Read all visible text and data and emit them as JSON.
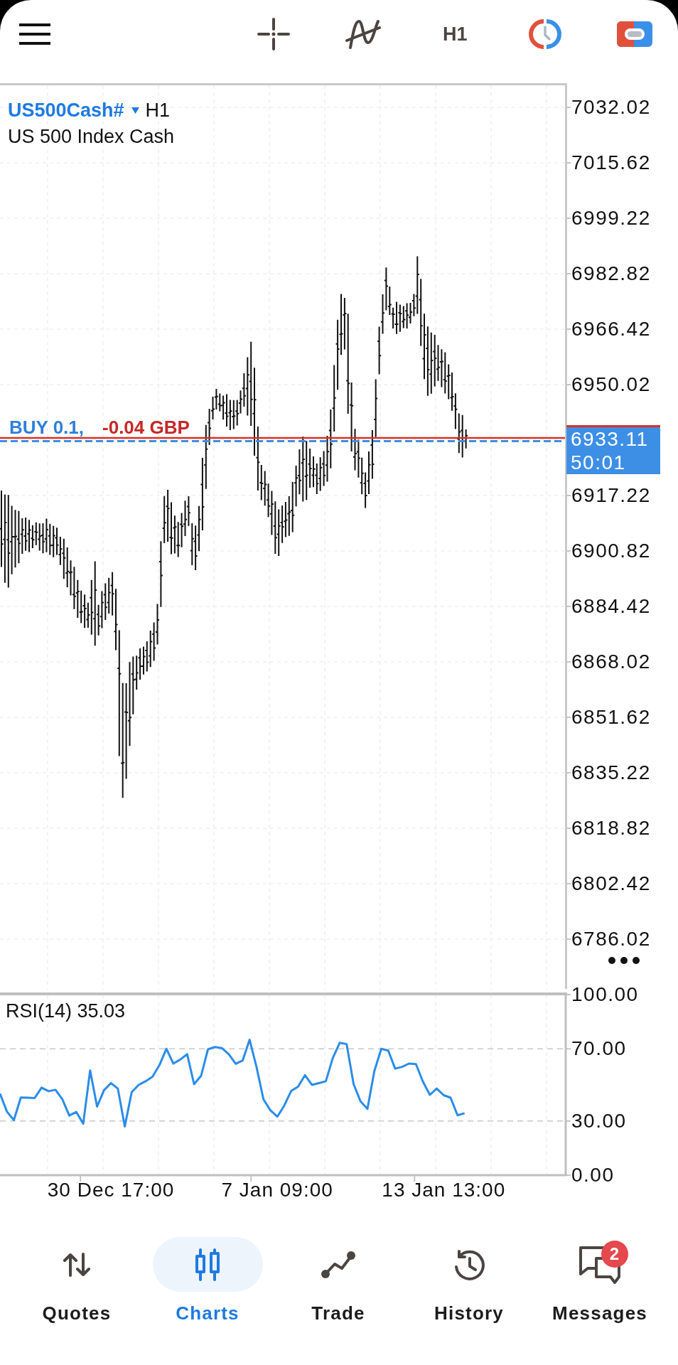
{
  "toolbar": {
    "timeframe": "H1"
  },
  "chart": {
    "symbol": "US500Cash#",
    "timeframe": "H1",
    "description": "US 500 Index Cash",
    "position": {
      "label": "BUY 0.1,",
      "profit": "-0.04 GBP"
    },
    "price_labels": [
      "7032.02",
      "7015.62",
      "6999.22",
      "6982.82",
      "6966.42",
      "6950.02",
      "6917.22",
      "6900.82",
      "6884.42",
      "6868.02",
      "6851.62",
      "6835.22",
      "6818.82",
      "6802.42",
      "6786.02"
    ],
    "current_price": {
      "price": "6933.11",
      "timer": "50:01"
    }
  },
  "indicator": {
    "chart_data": {
      "type": "line",
      "title": "RSI(14) 35.03",
      "categories": [
        null,
        null,
        null,
        null,
        null,
        null,
        null,
        null,
        null,
        null,
        null,
        null,
        null,
        null,
        null,
        null,
        "30 Dec 17:00",
        null,
        null,
        null,
        null,
        null,
        null,
        null,
        null,
        null,
        null,
        null,
        null,
        null,
        null,
        null,
        null,
        null,
        null,
        null,
        null,
        null,
        null,
        null,
        "7 Jan 09:00",
        null,
        null,
        null,
        null,
        null,
        null,
        null,
        null,
        null,
        null,
        null,
        null,
        null,
        null,
        null,
        null,
        null,
        null,
        null,
        null,
        null,
        null,
        null,
        "13 Jan 13:00",
        null,
        null,
        null,
        null,
        null,
        null,
        null,
        null,
        null,
        null,
        null,
        null,
        null,
        null,
        null,
        null,
        null
      ],
      "values": [
        45.1,
        35.2,
        30.5,
        43,
        42.9,
        42.7,
        48.5,
        46.5,
        47.3,
        42,
        33,
        35,
        28.5,
        58,
        38,
        47,
        51,
        48,
        27,
        46,
        50,
        52,
        54.5,
        61,
        70,
        61.8,
        64,
        67,
        50.4,
        55,
        69.7,
        71,
        70.4,
        67,
        61.7,
        63.5,
        75,
        60,
        42,
        36,
        32.4,
        38.5,
        46.6,
        49,
        55.4,
        50,
        51,
        52,
        64.8,
        73.3,
        72.6,
        50.5,
        41,
        36.7,
        57.6,
        70,
        69,
        59,
        60,
        61.8,
        61.5,
        51.9,
        44.5,
        48,
        44.3,
        42.9,
        33.2,
        34.3,
        null,
        null,
        null,
        null,
        null,
        null,
        null,
        null,
        null,
        null,
        null,
        null,
        null,
        null
      ],
      "ylim": [
        0,
        100
      ],
      "yticks": [
        {
          "value": 100,
          "label": "100.00"
        },
        {
          "value": 70,
          "label": "70.00"
        },
        {
          "value": 30,
          "label": "30.00"
        },
        {
          "value": 0,
          "label": "0.00"
        }
      ]
    }
  },
  "nav": [
    {
      "label": "Quotes",
      "selected": false
    },
    {
      "label": "Charts",
      "selected": true
    },
    {
      "label": "Trade",
      "selected": false
    },
    {
      "label": "History",
      "selected": false
    },
    {
      "label": "Messages",
      "selected": false,
      "badge": "2"
    }
  ]
}
